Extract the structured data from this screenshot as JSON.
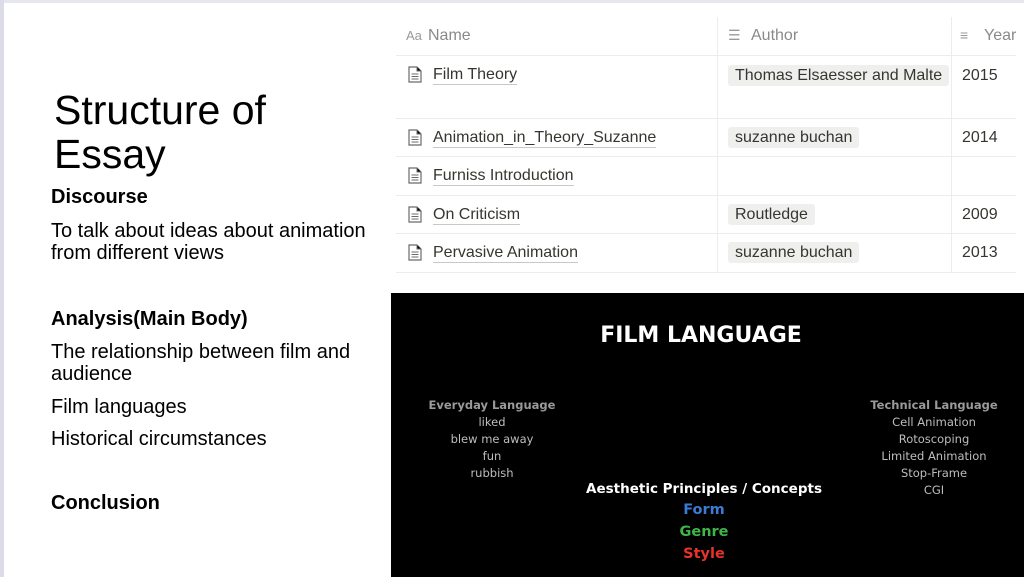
{
  "slide": {
    "title": "Structure of Essay",
    "sections": [
      {
        "heading": "Discourse",
        "lines": [
          "To talk about ideas about animation from different views"
        ]
      },
      {
        "heading": "Analysis(Main Body)",
        "lines": [
          "The relationship between film and audience",
          "Film languages",
          "Historical circumstances"
        ]
      },
      {
        "heading": "Conclusion",
        "lines": []
      }
    ]
  },
  "table": {
    "columns": [
      {
        "label": "Name",
        "icon": "aa-text-icon"
      },
      {
        "label": "Author",
        "icon": "list-icon"
      },
      {
        "label": "Year",
        "icon": "text-lines-icon"
      }
    ],
    "rows": [
      {
        "name": "Film Theory",
        "author": "Thomas Elsaesser and Malte",
        "year": "2015"
      },
      {
        "name": "Animation_in_Theory_Suzanne",
        "author": "suzanne buchan",
        "year": "2014"
      },
      {
        "name": "Furniss Introduction",
        "author": "",
        "year": ""
      },
      {
        "name": "On Criticism",
        "author": "Routledge",
        "year": "2009"
      },
      {
        "name": "Pervasive Animation",
        "author": "suzanne buchan",
        "year": "2013"
      }
    ]
  },
  "film_language": {
    "title": "FILM LANGUAGE",
    "everyday": {
      "heading": "Everyday Language",
      "items": [
        "liked",
        "blew me away",
        "fun",
        "rubbish"
      ]
    },
    "technical": {
      "heading": "Technical Language",
      "items": [
        "Cell Animation",
        "Rotoscoping",
        "Limited Animation",
        "Stop-Frame",
        "CGI"
      ]
    },
    "aesthetic": {
      "heading": "Aesthetic Principles / Concepts",
      "items": [
        {
          "label": "Form",
          "color": "#3a7bd5"
        },
        {
          "label": "Genre",
          "color": "#3db54a"
        },
        {
          "label": "Style",
          "color": "#e8322b"
        }
      ]
    }
  }
}
